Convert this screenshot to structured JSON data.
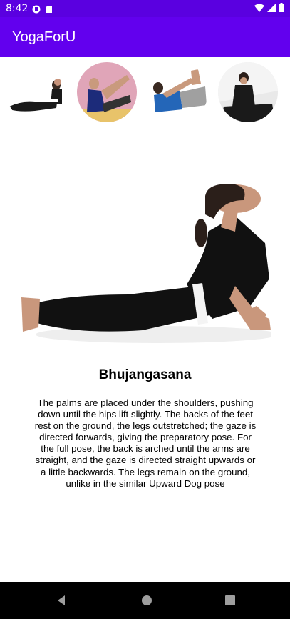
{
  "status_bar": {
    "time": "8:42",
    "icons": [
      "app-notification-icon",
      "sd-card-icon",
      "wifi-icon",
      "cell-signal-icon",
      "battery-icon"
    ]
  },
  "app_bar": {
    "title": "YogaForU",
    "color": "#6200ee",
    "status_color": "#5a00e0"
  },
  "pose_thumbnails": [
    {
      "name": "pose-thumb-1-icon"
    },
    {
      "name": "pose-thumb-2-icon"
    },
    {
      "name": "pose-thumb-3-icon"
    },
    {
      "name": "pose-thumb-4-icon"
    }
  ],
  "selected_pose": {
    "title": "Bhujangasana",
    "description": "The palms are placed under the shoulders, pushing down until the hips lift slightly. The backs of the feet rest on the ground, the legs outstretched; the gaze is directed forwards, giving the preparatory pose. For the full pose, the back is arched until the arms are straight, and the gaze is directed straight upwards or a little backwards. The legs remain on the ground, unlike in the similar Upward Dog pose"
  },
  "nav_bar": {
    "buttons": [
      "back-icon",
      "home-icon",
      "recents-icon"
    ]
  }
}
